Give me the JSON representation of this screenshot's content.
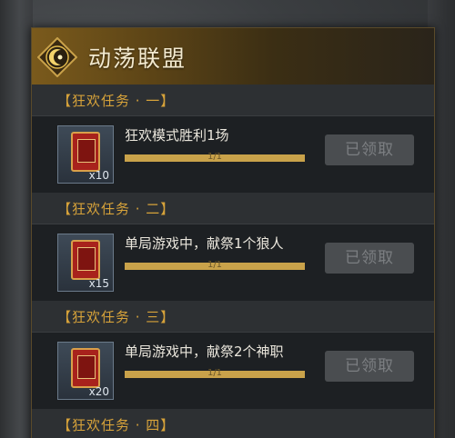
{
  "header": {
    "title": "动荡联盟",
    "emblem_icon": "crescent-moon-emblem-icon"
  },
  "sections": [
    {
      "label": "【狂欢任务 · 一】",
      "task": "狂欢模式胜利1场",
      "reward_qty": "x10",
      "progress_text": "1/1",
      "progress": 1.0,
      "button": "已领取"
    },
    {
      "label": "【狂欢任务 · 二】",
      "task": "单局游戏中，献祭1个狼人",
      "reward_qty": "x15",
      "progress_text": "1/1",
      "progress": 1.0,
      "button": "已领取"
    },
    {
      "label": "【狂欢任务 · 三】",
      "task": "单局游戏中，献祭2个神职",
      "reward_qty": "x20",
      "progress_text": "1/1",
      "progress": 1.0,
      "button": "已领取"
    },
    {
      "label": "【狂欢任务 · 四】"
    }
  ],
  "colors": {
    "accent_gold": "#c9a24a",
    "section_label": "#d6a23a",
    "reward_card": "#a8221c"
  }
}
